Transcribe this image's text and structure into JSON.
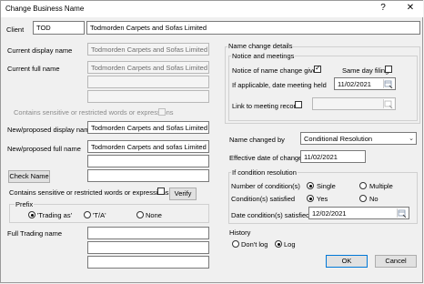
{
  "window": {
    "title": "Change Business Name",
    "help": "?",
    "close": "✕"
  },
  "client": {
    "label": "Client",
    "code": "TOD",
    "name": "Todmorden Carpets and Sofas Limited"
  },
  "current": {
    "display_label": "Current display name",
    "display_value": "Todmorden Carpets and Sofas Limited",
    "full_label": "Current full name",
    "full_lines": [
      "Todmorden Carpets and Sofas Limited",
      "",
      ""
    ],
    "sensitive_label": "Contains sensitive or restricted words or expressions"
  },
  "proposed": {
    "display_label": "New/proposed display name",
    "display_value": "Todmorden Carpets and Sofas Limited",
    "full_label": "New/proposed full name",
    "full_lines": [
      "Todmorden Carpets and sofas Limited",
      "",
      ""
    ],
    "check_button": "Check Name",
    "sensitive_label": "Contains sensitive or restricted words or expressions",
    "verify_button": "Verify"
  },
  "prefix": {
    "label": "Prefix",
    "options": [
      "'Trading as'",
      "'T/A'",
      "None"
    ],
    "selected": "'Trading as'"
  },
  "trading": {
    "label": "Full Trading name",
    "lines": [
      "",
      "",
      ""
    ]
  },
  "details": {
    "label": "Name change details",
    "notice_label": "Notice and meetings",
    "notice_given_label": "Notice of name change given",
    "notice_given": true,
    "same_day_label": "Same day filing",
    "same_day": false,
    "date_held_label": "If applicable, date meeting held",
    "date_held": "11/02/2021",
    "link_label": "Link to meeting record",
    "link_value": ""
  },
  "changed_by": {
    "label": "Name changed by",
    "value": "Conditional Resolution"
  },
  "effective": {
    "label": "Effective date of change",
    "value": "11/02/2021"
  },
  "condition": {
    "group_label": "If condition resolution",
    "number_label": "Number of condition(s)",
    "number_options": [
      "Single",
      "Multiple"
    ],
    "number_selected": "Single",
    "satisfied_label": "Condition(s) satisfied",
    "satisfied_options": [
      "Yes",
      "No"
    ],
    "satisfied_selected": "Yes",
    "date_label": "Date condition(s) satisfied",
    "date_value": "12/02/2021"
  },
  "history": {
    "label": "History",
    "options": [
      "Don't log",
      "Log"
    ],
    "selected": "Log"
  },
  "actions": {
    "ok": "OK",
    "cancel": "Cancel"
  }
}
